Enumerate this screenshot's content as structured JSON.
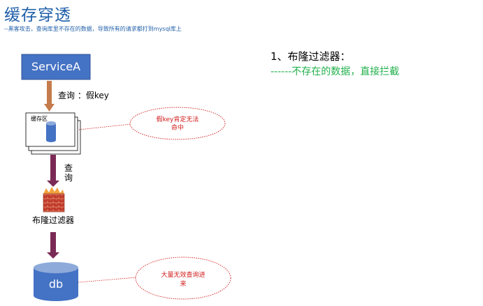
{
  "header": {
    "title": "缓存穿透",
    "subtitle": "--黑客攻击，查询库里不存在的数据，导致所有的请求都打到mysql库上"
  },
  "diagram": {
    "service_label": "ServiceA",
    "query_label": "查询 ：假key",
    "cache_label": "缓存区",
    "note_cache": [
      "假key肯定无法",
      "命中"
    ],
    "query_vertical": [
      "查",
      "询"
    ],
    "filter_label": "布隆过滤器",
    "db_label": "db",
    "note_db": [
      "大量无效查询进",
      "来"
    ]
  },
  "solution": {
    "title": "1、布隆过滤器：",
    "description": "------不存在的数据，直接拦截"
  },
  "colors": {
    "title": "#1f5fa8",
    "service_fill": "#4472c4",
    "arrow_orange": "#c57b4c",
    "arrow_purple": "#7b2a55",
    "note_red": "#d11818",
    "solution_green": "#22b14c"
  }
}
